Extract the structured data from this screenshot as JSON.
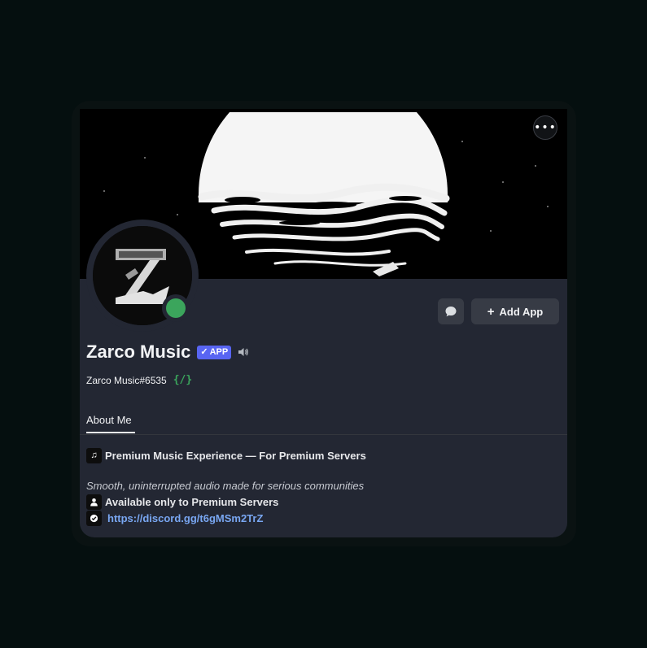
{
  "profile": {
    "display_name": "Zarco Music",
    "app_badge": "APP",
    "app_badge_check": "✓",
    "username": "Zarco Music#6535",
    "slash_badge": "{/}",
    "status_color": "#3ba55c",
    "more_icon": "•••"
  },
  "actions": {
    "add_app_plus": "+",
    "add_app_label": "Add App"
  },
  "tabs": [
    {
      "label": "About Me",
      "active": true
    }
  ],
  "about": {
    "line1_icon": "music-note-icon",
    "line1": "Premium Music Experience — For Premium Servers",
    "line2": "Smooth, uninterrupted audio made for serious communities",
    "line3_icon": "person-icon",
    "line3": "Available only to Premium Servers",
    "line4_icon": "check-badge-icon",
    "line4": "https://discord.gg/t6gMSm2TrZ"
  },
  "colors": {
    "background": "#050f0f",
    "card": "#232733",
    "accent": "#5865f2",
    "link": "#79a7f2"
  }
}
